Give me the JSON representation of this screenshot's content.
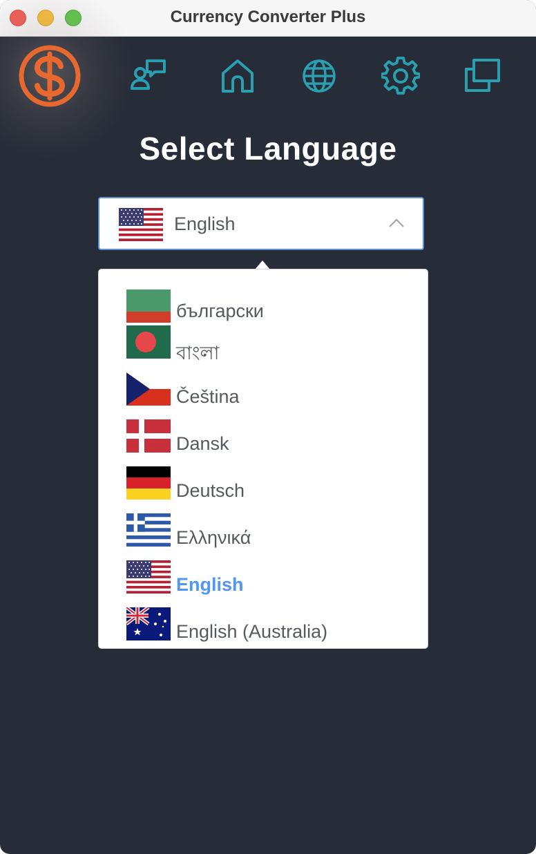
{
  "window": {
    "title": "Currency Converter Plus"
  },
  "nav": {
    "items": [
      {
        "icon": "chat-icon"
      },
      {
        "icon": "home-icon"
      },
      {
        "icon": "globe-icon"
      },
      {
        "icon": "gear-icon"
      },
      {
        "icon": "windows-icon"
      }
    ],
    "accent_color": "#2a9fb0"
  },
  "logo": {
    "icon": "dollar-logo-icon",
    "color": "#e8692f"
  },
  "page": {
    "heading": "Select Language"
  },
  "language_select": {
    "selected_flag": "us-flag-icon",
    "selected_label": "English",
    "options": [
      {
        "flag": "bulgaria-flag-icon",
        "label": "български",
        "selected": false
      },
      {
        "flag": "bangladesh-flag-icon",
        "label": "বাংলা",
        "selected": false
      },
      {
        "flag": "czech-flag-icon",
        "label": "Čeština",
        "selected": false
      },
      {
        "flag": "denmark-flag-icon",
        "label": "Dansk",
        "selected": false
      },
      {
        "flag": "germany-flag-icon",
        "label": "Deutsch",
        "selected": false
      },
      {
        "flag": "greece-flag-icon",
        "label": "Ελληνικά",
        "selected": true
      },
      {
        "flag": "us-flag-icon",
        "label": "English",
        "selected": true
      },
      {
        "flag": "australia-flag-icon",
        "label": "English (Australia)",
        "selected": false
      }
    ],
    "selected_color": "#4f97f0"
  }
}
